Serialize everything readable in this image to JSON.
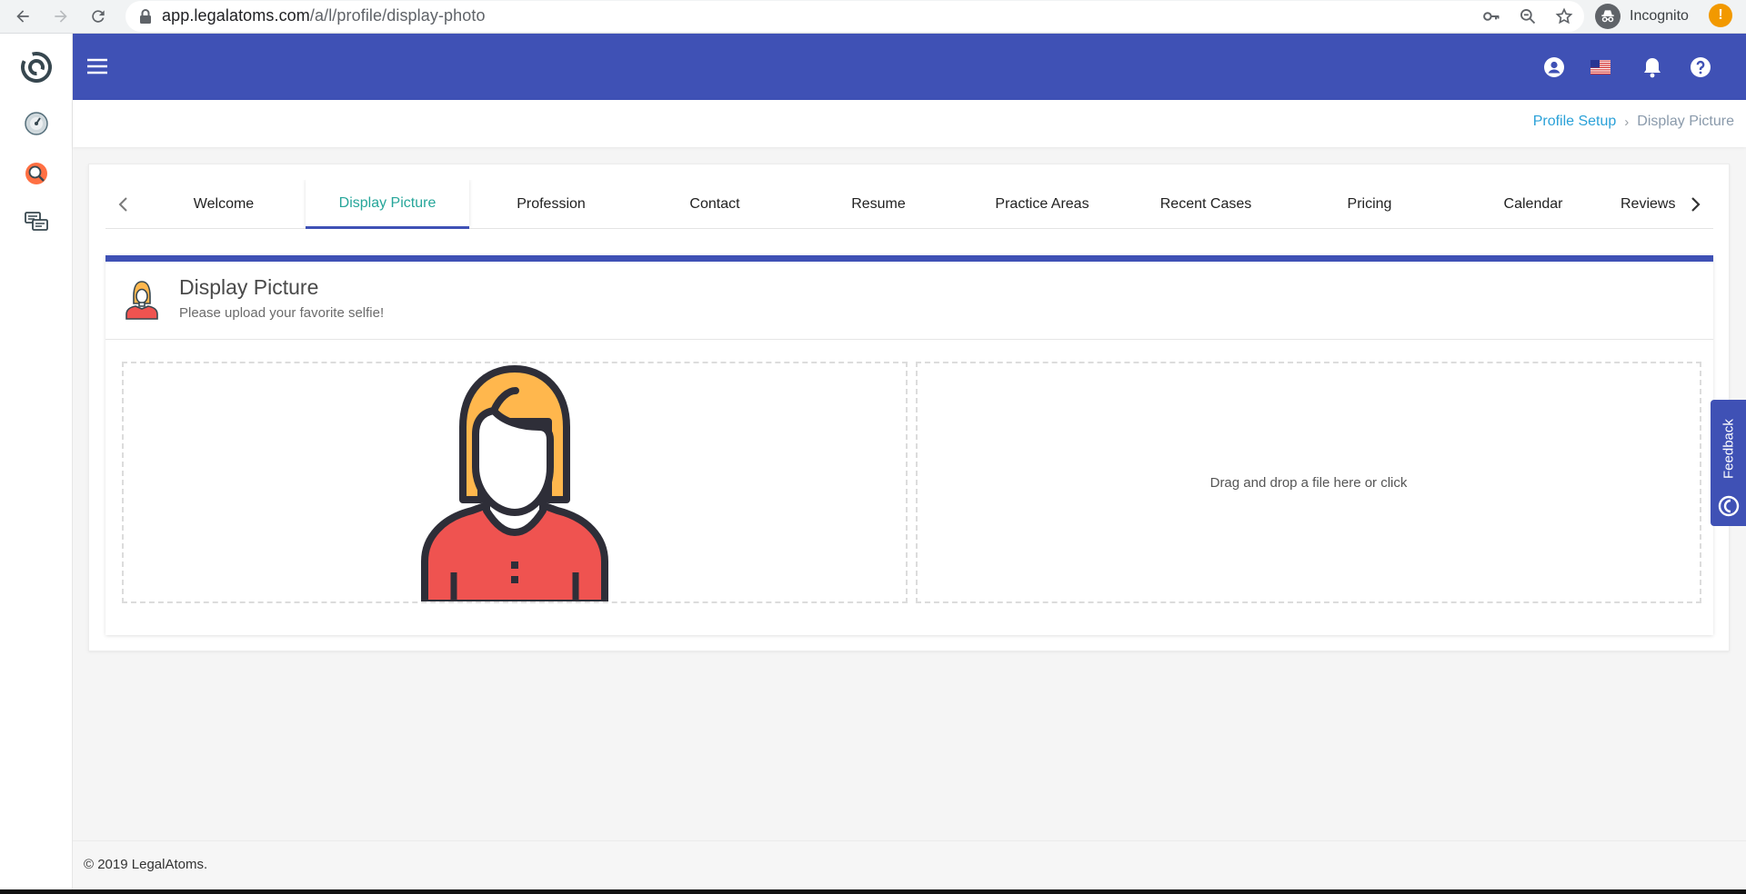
{
  "browser": {
    "url_host": "app.legalatoms.com",
    "url_path": "/a/l/profile/display-photo",
    "incognito_label": "Incognito",
    "alert_badge": "!",
    "icons": [
      "back-arrow-icon",
      "forward-arrow-icon",
      "reload-icon",
      "lock-icon",
      "key-icon",
      "zoom-icon",
      "star-icon",
      "incognito-icon"
    ]
  },
  "sidebar": {
    "items": [
      {
        "name": "dashboard-gauge-icon"
      },
      {
        "name": "profile-search-icon"
      },
      {
        "name": "chat-messages-icon"
      }
    ]
  },
  "header": {
    "icons": [
      "menu-icon",
      "account-icon",
      "us-flag-icon",
      "notifications-bell-icon",
      "help-icon"
    ],
    "color": "#3f51b5"
  },
  "breadcrumb": {
    "parent": "Profile Setup",
    "separator": "›",
    "current": "Display Picture"
  },
  "tabs": {
    "items": [
      {
        "label": "Welcome"
      },
      {
        "label": "Display Picture",
        "active": true
      },
      {
        "label": "Profession"
      },
      {
        "label": "Contact"
      },
      {
        "label": "Resume"
      },
      {
        "label": "Practice Areas"
      },
      {
        "label": "Recent Cases"
      },
      {
        "label": "Pricing"
      },
      {
        "label": "Calendar"
      },
      {
        "label": "Reviews"
      }
    ],
    "active_color": "#26a69a"
  },
  "panel": {
    "title": "Display Picture",
    "subtitle": "Please upload your favorite selfie!",
    "upload_text": "Drag and drop a file here or click"
  },
  "feedback": {
    "label": "Feedback"
  },
  "footer": {
    "copyright": "© 2019 LegalAtoms."
  }
}
